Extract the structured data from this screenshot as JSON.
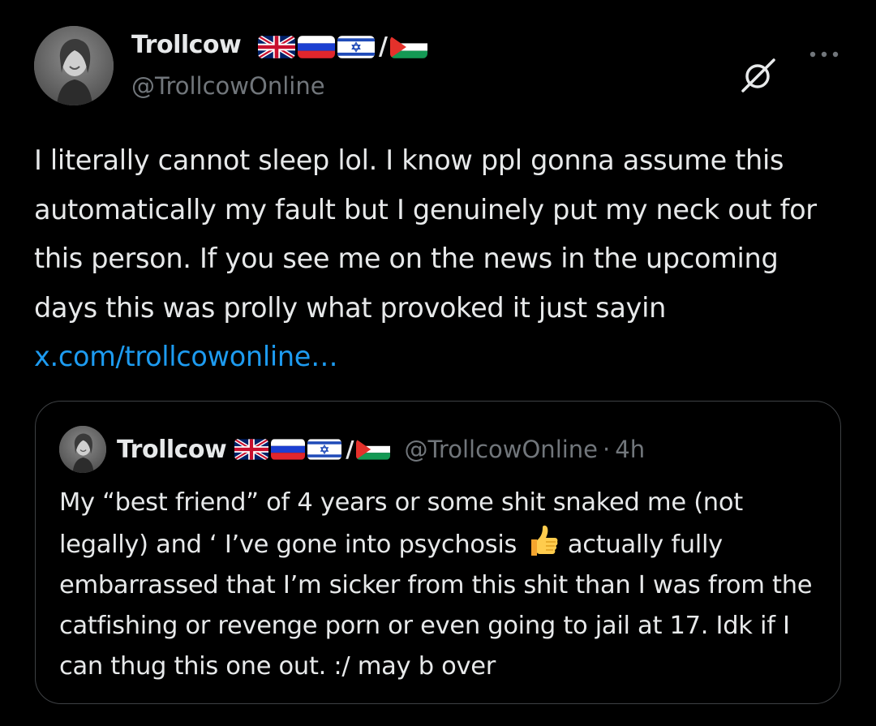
{
  "tweet": {
    "author": {
      "name": "Trollcow",
      "handle": "@TrollcowOnline",
      "flags": [
        "uk-flag-icon",
        "russia-flag-icon",
        "israel-flag-icon",
        "palestine-flag-icon"
      ],
      "flag_separator": "/"
    },
    "text_parts": [
      "I literally cannot sleep lol. I know ppl gonna assume this automatically my fault but I genuinely put my neck out for this person. If you see me on the news in the upcoming days this was prolly what provoked it just sayin "
    ],
    "link": "x.com/trollcowonline…",
    "icons": {
      "grok": "grok-icon",
      "more": "more-options-icon"
    }
  },
  "quote": {
    "author": {
      "name": "Trollcow",
      "handle": "@TrollcowOnline",
      "flag_separator": "/"
    },
    "separator": "·",
    "time": "4h",
    "text_before_emoji": "My “best friend” of 4 years or some shit snaked me (not legally) and ‘ I’ve gone into psychosis ",
    "emoji": "thumbs-up-emoji",
    "text_after_emoji": " actually fully embarrassed that I’m sicker from this shit than I was from the catfishing or revenge porn or even going to jail at 17. Idk if I can thug this one out. :/ may b over"
  },
  "colors": {
    "background": "#000000",
    "text": "#e7e9ea",
    "secondary": "#71767b",
    "link": "#1d9bf0",
    "border": "#3e4144"
  }
}
